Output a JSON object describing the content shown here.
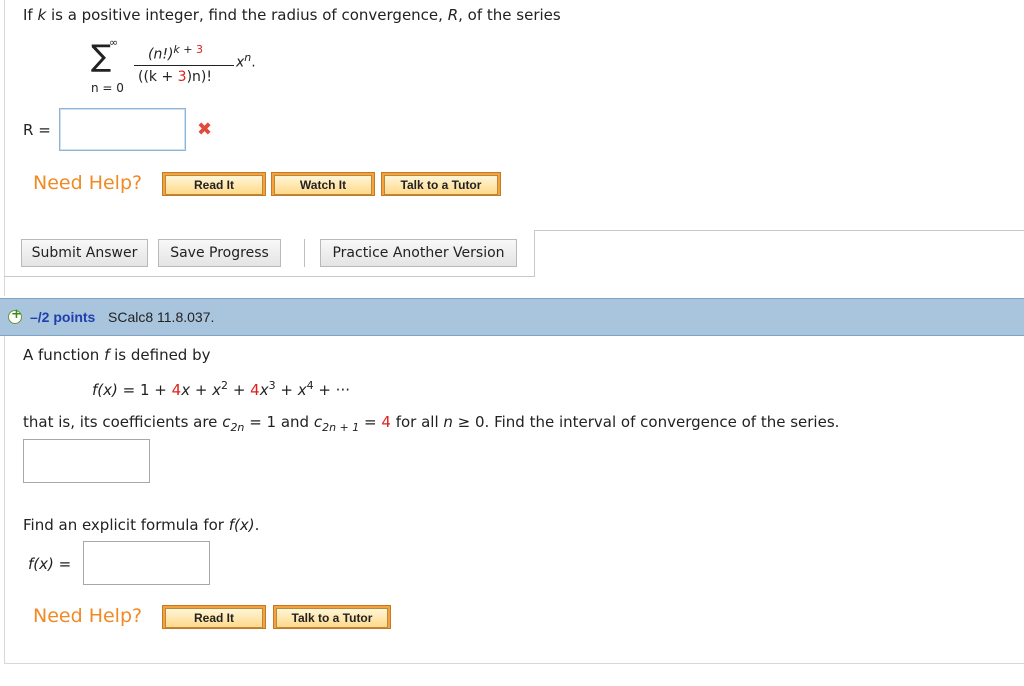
{
  "q1": {
    "prompt_pre": "If ",
    "prompt_k": "k",
    "prompt_mid": " is a positive integer, find the radius of convergence, ",
    "prompt_R": "R",
    "prompt_post": ", of the series",
    "sum_upper": "∞",
    "sum_symbol": "∑",
    "sum_lower": "n = 0",
    "numer_base": "(n!)",
    "numer_exp_k": "k",
    "numer_exp_plus": " + ",
    "numer_exp_3": "3",
    "denom_open": "((k + ",
    "denom_3": "3",
    "denom_close": ")n)!",
    "x_base": "x",
    "x_exp": "n",
    "period": ".",
    "answer_label": "R =",
    "answer_value": "",
    "incorrect_mark": "✖"
  },
  "help1": {
    "title": "Need Help?",
    "buttons": [
      "Read It",
      "Watch It",
      "Talk to a Tutor"
    ]
  },
  "actions": {
    "submit": "Submit Answer",
    "save": "Save Progress",
    "practice": "Practice Another Version"
  },
  "q2_header": {
    "expand_icon": "+",
    "points": "–/2 points",
    "code": "SCalc8 11.8.037."
  },
  "q2": {
    "intro_pre": "A function ",
    "intro_f": "f",
    "intro_post": " is defined by",
    "eq_lhs": "f(x)",
    "eq_eq": " = 1 + ",
    "eq_4a": "4",
    "eq_t1": "x + x",
    "eq_e2": "2",
    "eq_plus2": " + ",
    "eq_4b": "4",
    "eq_t3": "x",
    "eq_e3": "3",
    "eq_t4": " + x",
    "eq_e4": "4",
    "eq_end": " + ···",
    "coef_pre": "that is, its coefficients are ",
    "c2n": "c",
    "c2n_sub": "2n",
    "c2n_val": " = 1  and  ",
    "c2n1": "c",
    "c2n1_sub": "2n + 1",
    "c2n1_eq": " = ",
    "c2n1_val": "4",
    "coef_mid": "  for all  ",
    "coef_n": "n",
    "coef_post": " ≥ 0.  Find the interval of convergence of the series.",
    "interval_value": "",
    "formula_pre": "Find an explicit formula for ",
    "formula_fx": "f(x)",
    "formula_post": ".",
    "fx_label": "f(x)  =",
    "fx_value": ""
  },
  "help2": {
    "title": "Need Help?",
    "buttons": [
      "Read It",
      "Talk to a Tutor"
    ]
  },
  "colors": {
    "red_value": "#e0201b",
    "need_help": "#f08a24",
    "header_bg": "#a9c4dd",
    "points_blue": "#1f3fae"
  }
}
